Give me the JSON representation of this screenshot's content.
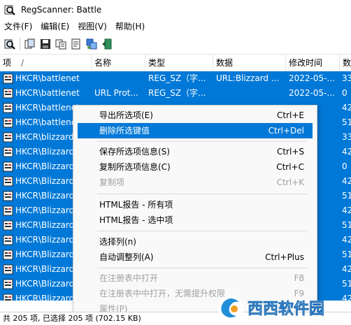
{
  "window": {
    "title": "RegScanner:   Battle"
  },
  "menu": [
    "文件(F)",
    "编辑(E)",
    "视图(V)",
    "帮助(H)"
  ],
  "toolbar": {
    "icons": [
      "scan-icon",
      "copy-icon",
      "save-icon",
      "copy-rows-icon",
      "properties-icon",
      "regedit-icon",
      "exit-icon"
    ]
  },
  "table": {
    "columns": [
      "项",
      "名称",
      "类型",
      "数据",
      "修改时间",
      "数"
    ],
    "rows": [
      {
        "key": "HKCR\\battlenet",
        "name": "",
        "type": "REG_SZ（字...",
        "data": "URL:Blizzard ...",
        "time": "2022-05-...",
        "extra": "33"
      },
      {
        "key": "HKCR\\battlenet",
        "name": "URL Prot...",
        "type": "REG_SZ（字...",
        "data": "",
        "time": "2022-05-...",
        "extra": "0"
      },
      {
        "key": "HKCR\\battlenet",
        "name": "",
        "type": "",
        "data": "",
        "time": "",
        "extra": "42"
      },
      {
        "key": "HKCR\\battlenet",
        "name": "",
        "type": "",
        "data": "",
        "time": "",
        "extra": "51"
      },
      {
        "key": "HKCR\\blizzard",
        "name": "",
        "type": "",
        "data": "",
        "time": "",
        "extra": "33"
      },
      {
        "key": "HKCR\\Blizzard",
        "name": "",
        "type": "",
        "data": "",
        "time": "",
        "extra": "42"
      },
      {
        "key": "HKCR\\Blizzard",
        "name": "",
        "type": "",
        "data": "",
        "time": "",
        "extra": "0"
      },
      {
        "key": "HKCR\\Blizzard",
        "name": "",
        "type": "",
        "data": "",
        "time": "",
        "extra": "42"
      },
      {
        "key": "HKCR\\Blizzard",
        "name": "",
        "type": "",
        "data": "",
        "time": "",
        "extra": "51"
      },
      {
        "key": "HKCR\\Blizzard",
        "name": "",
        "type": "",
        "data": "",
        "time": "",
        "extra": "42"
      },
      {
        "key": "HKCR\\Blizzard",
        "name": "",
        "type": "",
        "data": "",
        "time": "",
        "extra": "51"
      },
      {
        "key": "HKCR\\Blizzard",
        "name": "",
        "type": "",
        "data": "",
        "time": "",
        "extra": "42"
      },
      {
        "key": "HKCR\\Blizzard",
        "name": "",
        "type": "",
        "data": "",
        "time": "",
        "extra": "51"
      },
      {
        "key": "HKCR\\Blizzard",
        "name": "",
        "type": "",
        "data": "",
        "time": "",
        "extra": "42"
      },
      {
        "key": "HKCR\\Blizzard",
        "name": "",
        "type": "",
        "data": "",
        "time": "",
        "extra": "51"
      },
      {
        "key": "HKCR\\Blizzard",
        "name": "",
        "type": "",
        "data": "",
        "time": "",
        "extra": "42"
      }
    ]
  },
  "context_menu": {
    "export": {
      "label": "导出所选项(E)",
      "shortcut": "Ctrl+E"
    },
    "delete": {
      "label": "删除所选键值",
      "shortcut": "Ctrl+Del"
    },
    "save_info": {
      "label": "保存所选项信息(S)",
      "shortcut": "Ctrl+S"
    },
    "copy_info": {
      "label": "复制所选项信息(C)",
      "shortcut": "Ctrl+C"
    },
    "copy_item": {
      "label": "复制项",
      "shortcut": "Ctrl+K"
    },
    "html_all": {
      "label": "HTML报告 - 所有项",
      "shortcut": ""
    },
    "html_sel": {
      "label": "HTML报告 - 选中项",
      "shortcut": ""
    },
    "choose_cols": {
      "label": "选择列(n)",
      "shortcut": ""
    },
    "auto_size": {
      "label": "自动调整列(A)",
      "shortcut": "Ctrl+Plus"
    },
    "open_regedit": {
      "label": "在注册表中打开",
      "shortcut": "F8"
    },
    "open_regedit_noelev": {
      "label": "在注册表中中打开，无需提升权限",
      "shortcut": "F9"
    },
    "properties": {
      "label": "属性(P)",
      "shortcut": ""
    }
  },
  "status": {
    "text": "共 205 项, 已选择 205 项  (702.15 KB)"
  },
  "watermark": {
    "text": "西西软件园"
  },
  "colors": {
    "selection": "#0078d7",
    "menu_bg": "#f9f9f9",
    "disabled": "#a0a0a0"
  }
}
